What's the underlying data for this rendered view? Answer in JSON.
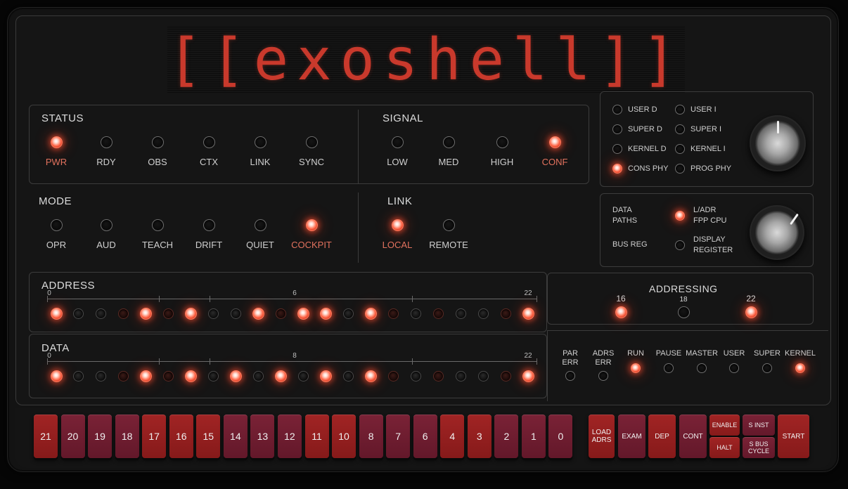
{
  "logo": {
    "text": "[[exoshell]]"
  },
  "status": {
    "title": "STATUS",
    "items": [
      {
        "label": "PWR",
        "on": true
      },
      {
        "label": "RDY",
        "on": false
      },
      {
        "label": "OBS",
        "on": false
      },
      {
        "label": "CTX",
        "on": false
      },
      {
        "label": "LINK",
        "on": false
      },
      {
        "label": "SYNC",
        "on": false
      }
    ]
  },
  "signal": {
    "title": "SIGNAL",
    "items": [
      {
        "label": "LOW",
        "on": false
      },
      {
        "label": "MED",
        "on": false
      },
      {
        "label": "HIGH",
        "on": false
      },
      {
        "label": "CONF",
        "on": true
      }
    ]
  },
  "mode": {
    "title": "MODE",
    "items": [
      {
        "label": "OPR",
        "on": false
      },
      {
        "label": "AUD",
        "on": false
      },
      {
        "label": "TEACH",
        "on": false
      },
      {
        "label": "DRIFT",
        "on": false
      },
      {
        "label": "QUIET",
        "on": false
      },
      {
        "label": "COCKPIT",
        "on": true
      }
    ]
  },
  "link": {
    "title": "LINK",
    "items": [
      {
        "label": "LOCAL",
        "on": true
      },
      {
        "label": "REMOTE",
        "on": false
      }
    ]
  },
  "space_selector": {
    "items": [
      {
        "label": "USER D",
        "on": false
      },
      {
        "label": "USER I",
        "on": false
      },
      {
        "label": "SUPER D",
        "on": false
      },
      {
        "label": "SUPER I",
        "on": false
      },
      {
        "label": "KERNEL D",
        "on": false
      },
      {
        "label": "KERNEL I",
        "on": false
      },
      {
        "label": "CONS PHY",
        "on": true
      },
      {
        "label": "PROG PHY",
        "on": false
      }
    ]
  },
  "data_selector": {
    "left_top": "DATA\nPATHS",
    "left_bottom": "BUS REG",
    "options": [
      {
        "label": "L/ADR\nFPP CPU",
        "on": true
      },
      {
        "label": "DISPLAY\nREGISTER",
        "on": false
      }
    ]
  },
  "address": {
    "title": "ADDRESS",
    "scale": [
      "0",
      "6",
      "22"
    ],
    "bits": [
      1,
      0,
      0,
      0,
      1,
      0,
      1,
      0,
      0,
      1,
      0,
      1,
      1,
      0,
      1,
      0,
      0,
      0,
      0,
      0,
      0,
      1
    ]
  },
  "data": {
    "title": "DATA",
    "scale": [
      "0",
      "8",
      "22"
    ],
    "bits": [
      1,
      0,
      0,
      0,
      1,
      0,
      1,
      0,
      1,
      0,
      1,
      0,
      1,
      0,
      1,
      0,
      0,
      0,
      0,
      0,
      0,
      1
    ]
  },
  "addressing": {
    "title": "ADDRESSING",
    "items": [
      {
        "label": "16",
        "on": true
      },
      {
        "label": "18",
        "on": false
      },
      {
        "label": "22",
        "on": true
      }
    ]
  },
  "cpu_status": {
    "items": [
      {
        "label": "PAR\nERR",
        "on": false
      },
      {
        "label": "ADRS\nERR",
        "on": false
      },
      {
        "label": "RUN",
        "on": true
      },
      {
        "label": "PAUSE",
        "on": false
      },
      {
        "label": "MASTER",
        "on": false
      },
      {
        "label": "USER",
        "on": false
      },
      {
        "label": "SUPER",
        "on": false
      },
      {
        "label": "KERNEL",
        "on": true
      }
    ]
  },
  "switches": {
    "labels": [
      "21",
      "20",
      "19",
      "18",
      "17",
      "16",
      "15",
      "14",
      "13",
      "12",
      "11",
      "10",
      "8",
      "7",
      "6",
      "4",
      "3",
      "2",
      "1",
      "0"
    ],
    "colors": [
      "red",
      "wine",
      "wine",
      "wine",
      "red",
      "red",
      "red",
      "wine",
      "wine",
      "wine",
      "red",
      "red",
      "wine",
      "wine",
      "wine",
      "red",
      "red",
      "wine",
      "wine",
      "wine"
    ]
  },
  "controls": {
    "load_adrs": "LOAD\nADRS",
    "exam": "EXAM",
    "dep": "DEP",
    "cont": "CONT",
    "enable": "ENABLE",
    "halt": "HALT",
    "s_inst": "S INST",
    "s_bus_cycle": "S BUS\nCYCLE",
    "start": "START"
  },
  "colors": {
    "accent": "#c9392c",
    "led_on": "#ff6a4c",
    "switch_red": "#a12424",
    "switch_wine": "#7a2236"
  }
}
